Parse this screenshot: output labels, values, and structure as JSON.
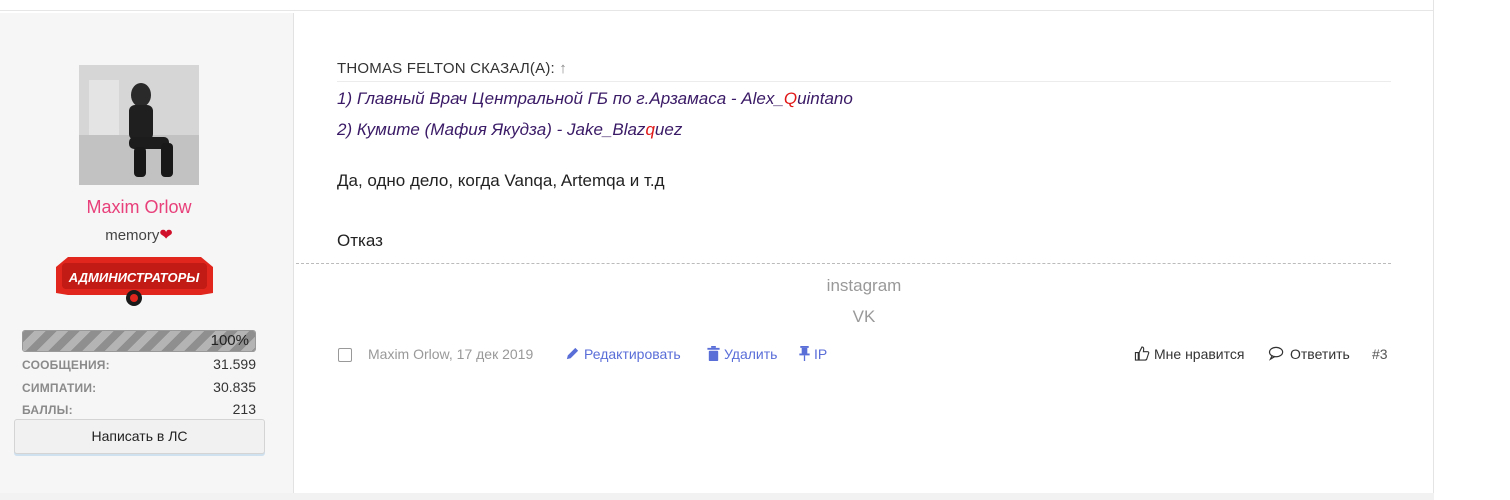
{
  "user": {
    "name": "Maxim Orlow",
    "title": "memory",
    "title_icon": "heart-icon",
    "banner_label": "АДМИНИСТРАТОРЫ",
    "progress": "100%",
    "progress_value": 1.0,
    "stats": [
      {
        "label": "СООБЩЕНИЯ:",
        "value": "31.599"
      },
      {
        "label": "СИМПАТИИ:",
        "value": "30.835"
      },
      {
        "label": "БАЛЛЫ:",
        "value": "213"
      }
    ],
    "pm_button": "Написать в ЛС"
  },
  "post": {
    "quote": {
      "author_header": "THOMAS FELTON СКАЗАЛ(А):",
      "arrow": "↑",
      "line1": {
        "pre": "1) Главный Врач Центральной ГБ по г.Арзамаса - Alex_",
        "red": "Q",
        "post": "uintano"
      },
      "line2": {
        "pre": "2) Кумите (Мафия Якудза) - Jake_Blaz",
        "red": "q",
        "post": "uez"
      }
    },
    "body_lines": [
      "Да, одно дело, когда Vanqa, Artemqa и т.д",
      "Отказ"
    ],
    "signature": [
      "instagram",
      "VK"
    ]
  },
  "footer": {
    "author_date": "Maxim Orlow, 17 дек 2019",
    "edit": "Редактировать",
    "delete": "Удалить",
    "ip": "IP",
    "like": "Мне нравится",
    "reply": "Ответить",
    "post_number": "#3"
  },
  "colors": {
    "username": "#e8407a",
    "quote_text": "#3a1a66",
    "quote_highlight": "#e01515",
    "action_link": "#5a6ed8"
  }
}
